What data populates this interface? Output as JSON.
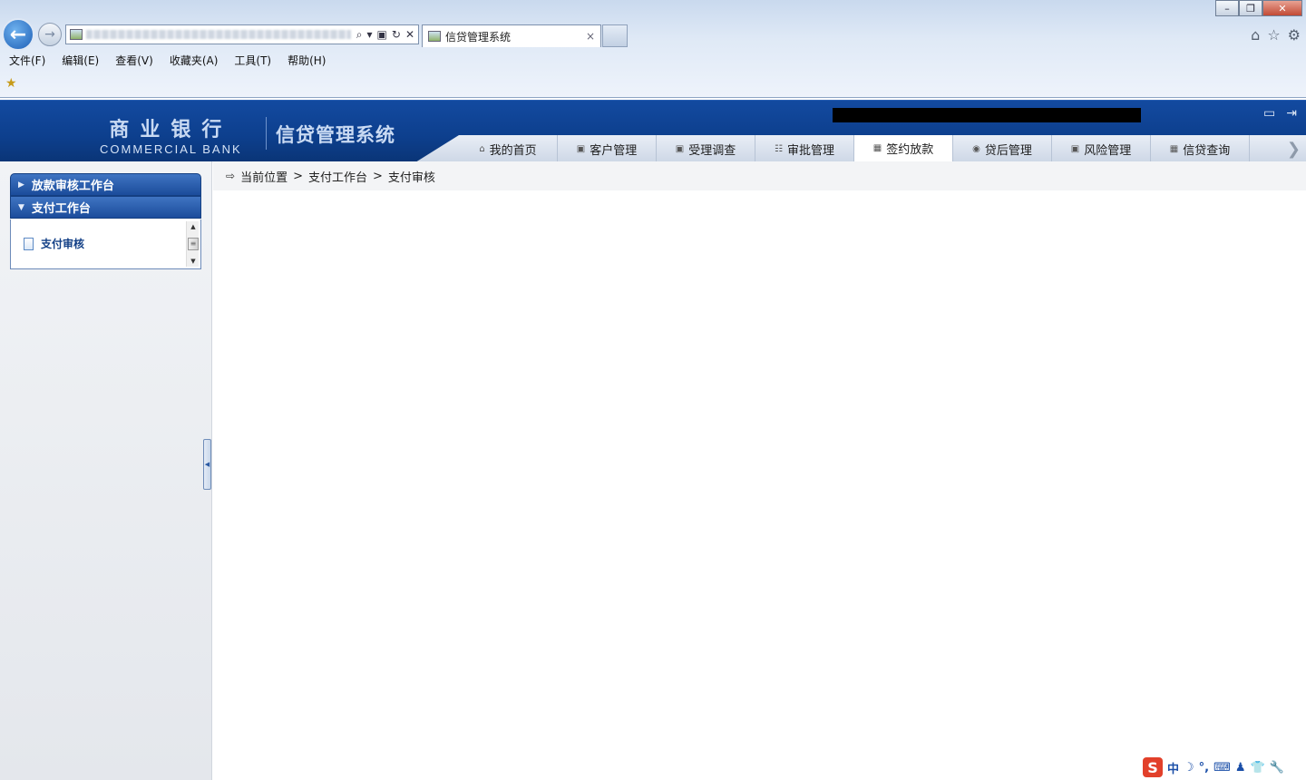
{
  "browser": {
    "tab_title": "信贷管理系统",
    "tab_close": "×",
    "menu": [
      "文件(F)",
      "编辑(E)",
      "查看(V)",
      "收藏夹(A)",
      "工具(T)",
      "帮助(H)"
    ],
    "window_controls": {
      "minimize": "–",
      "restore": "❐",
      "close": "✕"
    },
    "address_tools": {
      "search": "⌕",
      "dropdown": "▾",
      "compat": "▣",
      "refresh": "↻",
      "stop": "✕"
    },
    "right_icons": {
      "home": "⌂",
      "favorites": "☆",
      "settings": "⚙"
    },
    "back": "←",
    "forward": "→",
    "favorites_bar_icon": "★"
  },
  "header": {
    "bank_name_cn": "商业银行",
    "bank_name_en": "COMMERCIAL BANK",
    "system_name": "信贷管理系统",
    "icons": {
      "screen": "▭",
      "logout": "⇥"
    }
  },
  "nav": {
    "items": [
      {
        "label": "我的首页",
        "icon": "⌂"
      },
      {
        "label": "客户管理",
        "icon": "▣"
      },
      {
        "label": "受理调查",
        "icon": "▣"
      },
      {
        "label": "审批管理",
        "icon": "☷"
      },
      {
        "label": "签约放款",
        "icon": "▦"
      },
      {
        "label": "贷后管理",
        "icon": "◉"
      },
      {
        "label": "风险管理",
        "icon": "▣"
      },
      {
        "label": "信贷查询",
        "icon": "▦"
      }
    ],
    "active": "签约放款",
    "more_arrow": "❯"
  },
  "sidebar": {
    "groups": [
      {
        "title": "放款审核工作台",
        "expanded": false,
        "marker": "▶"
      },
      {
        "title": "支付工作台",
        "expanded": true,
        "marker": "▼",
        "items": [
          "支付审核"
        ]
      }
    ],
    "scroll": {
      "up": "▲",
      "thumb": "≡",
      "down": "▼"
    },
    "collapse_marker": "◀"
  },
  "breadcrumb": {
    "icon": "⇨",
    "prefix": "当前位置",
    "separator": ">",
    "path": [
      "支付工作台",
      "支付审核"
    ]
  },
  "ime": {
    "logo": "S",
    "lang": "中",
    "icons": [
      "☽",
      "°,",
      "⌨",
      "♟",
      "👕",
      "🔧"
    ]
  },
  "colors": {
    "header_blue": "#0d3f8d",
    "accent": "#1b4c9b",
    "active_tab_bg": "#ffffff"
  }
}
